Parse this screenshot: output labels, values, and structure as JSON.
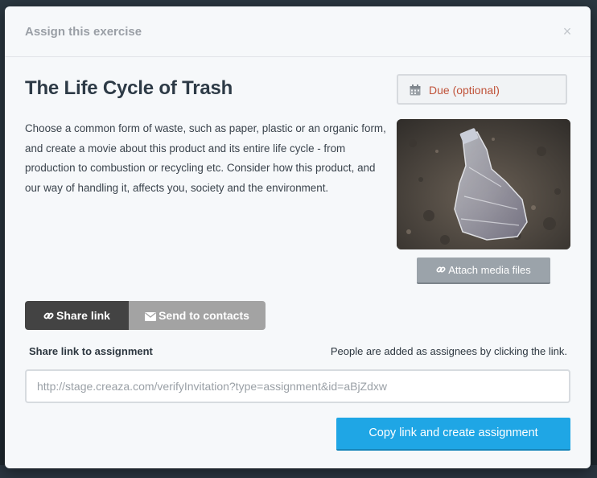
{
  "modal": {
    "title": "Assign this exercise",
    "close_glyph": "×"
  },
  "exercise": {
    "title": "The Life Cycle of Trash",
    "description": "Choose a common form of waste, such as paper, plastic or an organic form, and create a movie about this product and its entire life cycle - from production to combustion or recycling etc. Consider how this product, and our way of handling it, affects you, society and the environment."
  },
  "due": {
    "label": "Due (optional)",
    "icon": "calendar-icon"
  },
  "media": {
    "attach_label": "Attach media files",
    "icon": "link-icon"
  },
  "tabs": [
    {
      "label": "Share link",
      "icon": "link-icon",
      "active": true
    },
    {
      "label": "Send to contacts",
      "icon": "envelope-icon",
      "active": false
    }
  ],
  "share": {
    "heading": "Share link to assignment",
    "note": "People are added as assignees by clicking the link.",
    "link_placeholder": "http://stage.creaza.com/verifyInvitation?type=assignment&id=aBjZdxw"
  },
  "actions": {
    "copy_label": "Copy link and create assignment"
  },
  "colors": {
    "accent": "#1fa6e5",
    "due_text": "#c0533a",
    "tab_active": "#434343",
    "tab_inactive": "#a3a3a3"
  }
}
